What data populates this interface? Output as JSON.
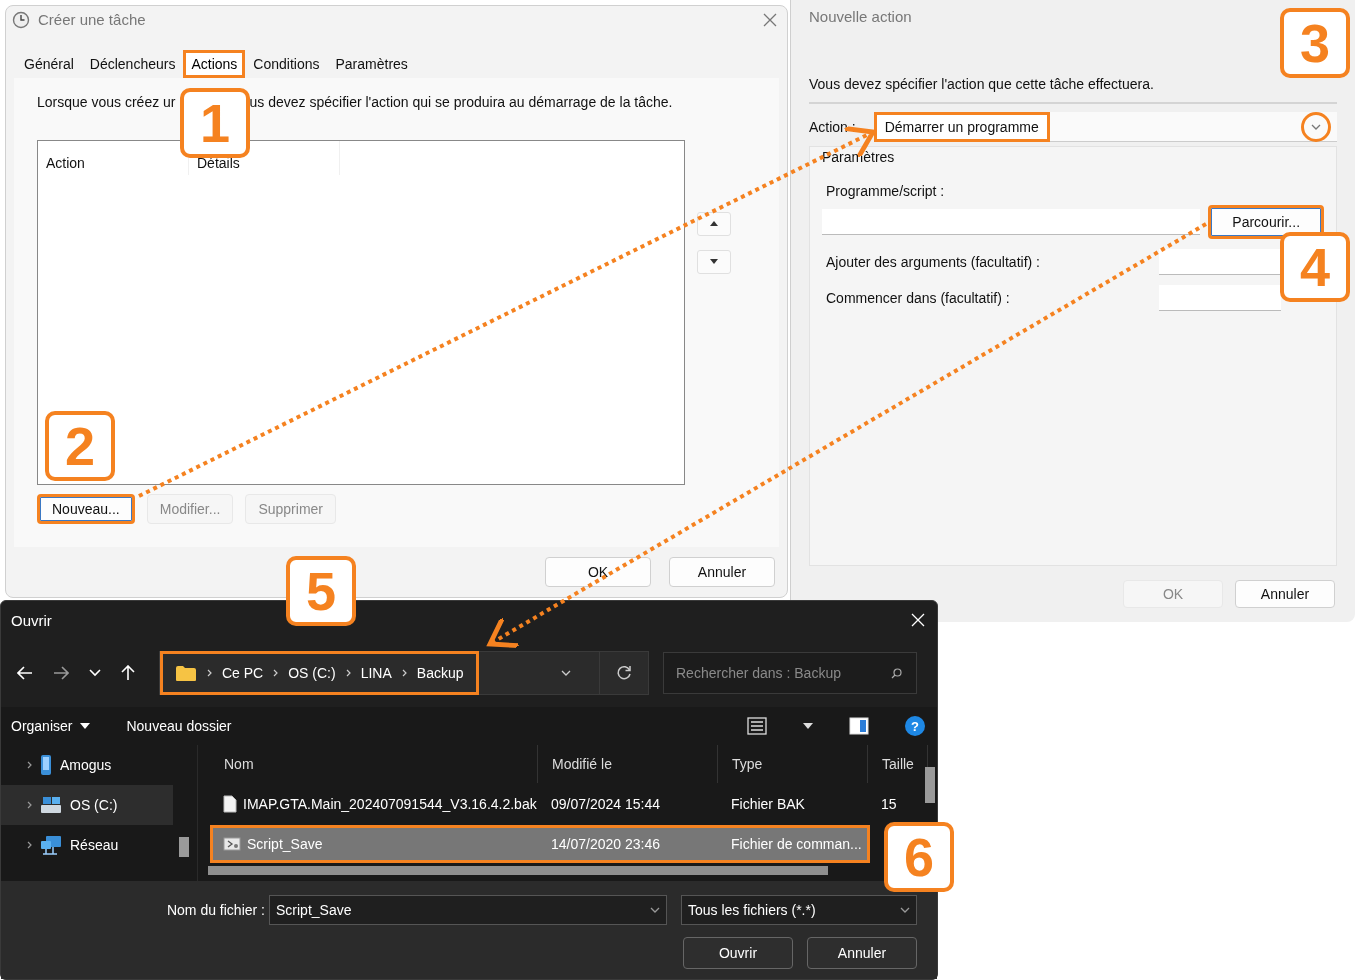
{
  "task_window": {
    "title": "Créer une tâche",
    "tabs": [
      {
        "label": "Général",
        "selected": false,
        "highlighted": false
      },
      {
        "label": "Déclencheurs",
        "selected": false,
        "highlighted": false
      },
      {
        "label": "Actions",
        "selected": true,
        "highlighted": true
      },
      {
        "label": "Conditions",
        "selected": false,
        "highlighted": false
      },
      {
        "label": "Paramètres",
        "selected": false,
        "highlighted": false
      }
    ],
    "instruction_parts": [
      "Lorsque vous créez ur",
      "us devez spécifier l'action qui se produira au démarrage de la tâche."
    ],
    "list_columns": [
      "Action",
      "Détails"
    ],
    "list_buttons": [
      {
        "label": "Nouveau...",
        "disabled": false,
        "highlighted": true
      },
      {
        "label": "Modifier...",
        "disabled": true,
        "highlighted": false
      },
      {
        "label": "Supprimer",
        "disabled": true,
        "highlighted": false
      }
    ],
    "buttons": [
      "OK",
      "Annuler"
    ]
  },
  "action_window": {
    "title": "Nouvelle action",
    "instruction": "Vous devez spécifier l'action que cette tâche effectuera.",
    "action_label": "Action :",
    "action_value": "Démarrer un programme",
    "action_highlighted": true,
    "dropdown_circled": true,
    "group_label": "Paramètres",
    "program_label": "Programme/script :",
    "browse_button": "Parcourir...",
    "browse_highlighted": true,
    "fields": [
      {
        "label": "Ajouter des arguments (facultatif) :"
      },
      {
        "label": "Commencer dans (facultatif) :"
      }
    ],
    "buttons": [
      {
        "label": "OK",
        "disabled": true
      },
      {
        "label": "Annuler",
        "disabled": false
      }
    ]
  },
  "open_dialog": {
    "title": "Ouvrir",
    "breadcrumb": [
      "Ce PC",
      "OS (C:)",
      "LINA",
      "Backup"
    ],
    "breadcrumb_highlighted": true,
    "search_placeholder": "Rechercher dans : Backup",
    "organize_label": "Organiser",
    "new_folder_label": "Nouveau dossier",
    "help_glyph": "?",
    "nav_items": [
      {
        "label": "Amogus",
        "kind": "device",
        "selected": false
      },
      {
        "label": "OS (C:)",
        "kind": "drive",
        "selected": true
      },
      {
        "label": "Réseau",
        "kind": "network",
        "selected": false
      }
    ],
    "columns": [
      "Nom",
      "Modifié le",
      "Type",
      "Taille"
    ],
    "files": [
      {
        "name": "IMAP.GTA.Main_202407091544_V3.16.4.2.bak",
        "modified": "09/07/2024 15:44",
        "type": "Fichier BAK",
        "size": "15",
        "kind": "file",
        "selected": false,
        "highlighted": false
      },
      {
        "name": "Script_Save",
        "modified": "14/07/2020 23:46",
        "type": "Fichier de comman...",
        "kind": "script",
        "selected": true,
        "highlighted": true
      }
    ],
    "filename_label": "Nom du fichier :",
    "filename_value": "Script_Save",
    "filter_value": "Tous les fichiers (*.*)",
    "buttons": [
      "Ouvrir",
      "Annuler"
    ]
  },
  "annotations": [
    {
      "label": "1"
    },
    {
      "label": "2"
    },
    {
      "label": "3"
    },
    {
      "label": "4"
    },
    {
      "label": "5"
    },
    {
      "label": "6"
    }
  ]
}
